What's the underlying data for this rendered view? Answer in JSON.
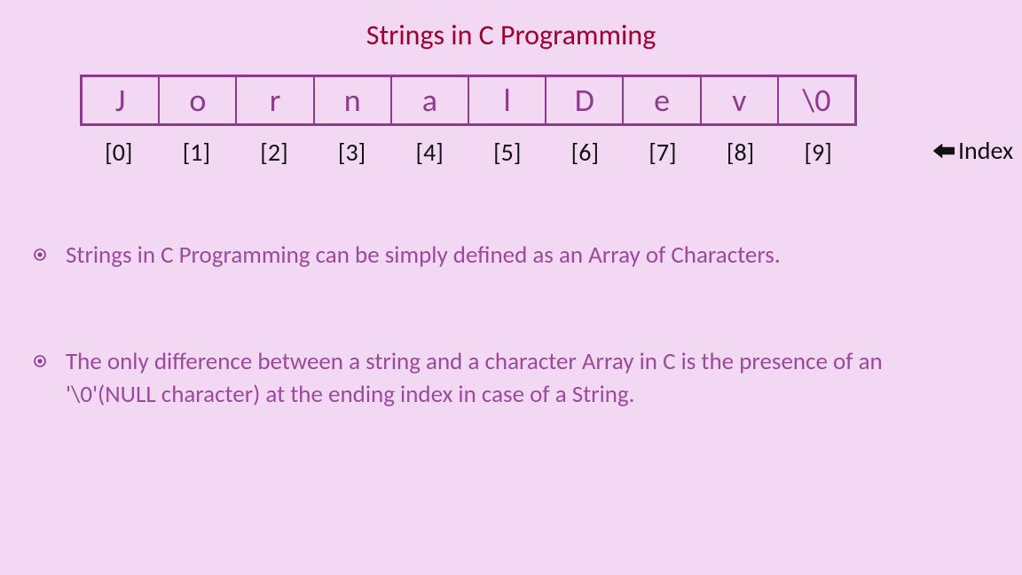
{
  "title": "Strings in C Programming",
  "cells": [
    "J",
    "o",
    "r",
    "n",
    "a",
    "l",
    "D",
    "e",
    "v",
    "\\0"
  ],
  "indices": [
    "[0]",
    "[1]",
    "[2]",
    "[3]",
    "[4]",
    "[5]",
    "[6]",
    "[7]",
    "[8]",
    "[9]"
  ],
  "index_label": "Index",
  "bullets": [
    "Strings in C Programming can be simply defined as an Array of Characters.",
    "The only difference between a string and a character Array in C is the presence of an '\\0'(NULL character) at the ending index in case of a String."
  ],
  "colors": {
    "bg": "#f3d8f3",
    "cell_border": "#8e3a8e",
    "title": "#a00030",
    "text_purple": "#9b4a9b"
  }
}
